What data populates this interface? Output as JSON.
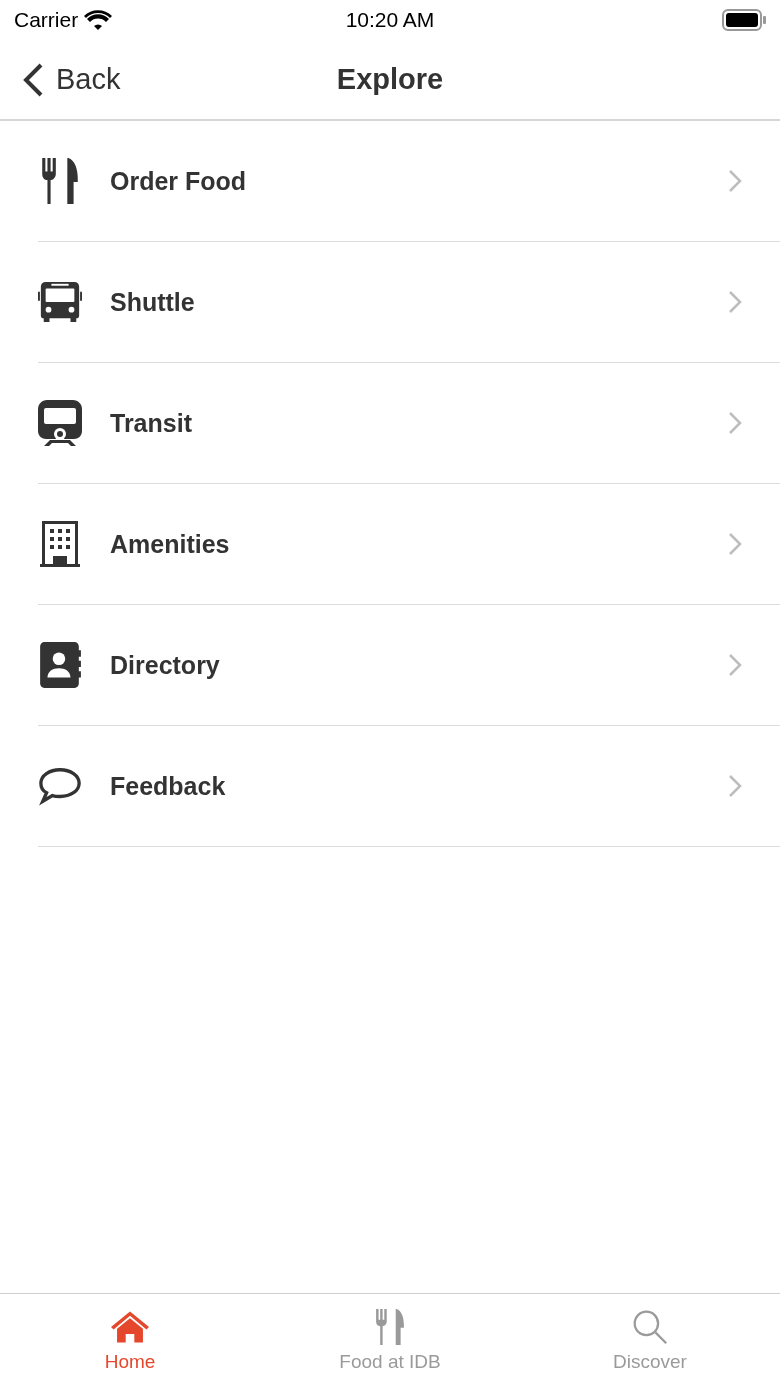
{
  "status_bar": {
    "carrier": "Carrier",
    "time": "10:20 AM"
  },
  "nav": {
    "back": "Back",
    "title": "Explore"
  },
  "items": [
    {
      "label": "Order Food"
    },
    {
      "label": "Shuttle"
    },
    {
      "label": "Transit"
    },
    {
      "label": "Amenities"
    },
    {
      "label": "Directory"
    },
    {
      "label": "Feedback"
    }
  ],
  "tabs": [
    {
      "label": "Home",
      "selected": true
    },
    {
      "label": "Food at IDB",
      "selected": false
    },
    {
      "label": "Discover",
      "selected": false
    }
  ]
}
